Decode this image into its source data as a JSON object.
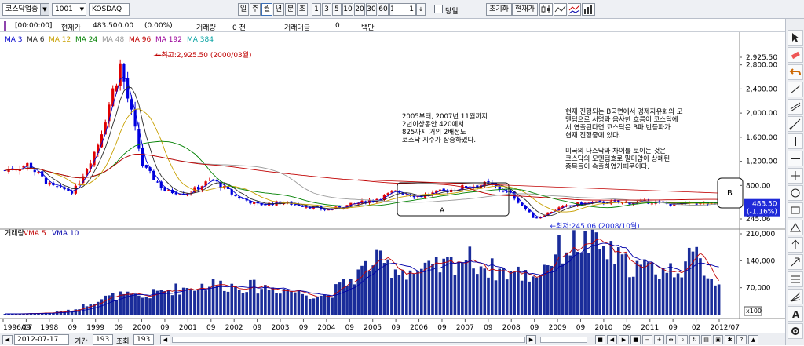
{
  "toolbar": {
    "index_select": "코스닥업종",
    "index_code": "1001",
    "index_name": "KOSDAQ",
    "periods": [
      "일",
      "주",
      "월",
      "년",
      "분",
      "초"
    ],
    "active_period": "월",
    "intervals": [
      "1",
      "3",
      "5",
      "10",
      "20",
      "30",
      "60",
      "120"
    ],
    "spin_value": "1",
    "checkbox_label": "당일",
    "reset_label": "초기화",
    "current_label": "현재가"
  },
  "info": {
    "time": "[00:00:00]",
    "price_label": "현재가",
    "price": "483.50",
    "change": "0.00",
    "change_pct": "(0.00%)",
    "volume_label": "거래량",
    "volume": "0 천",
    "amount_label": "거래대금",
    "amount": "0",
    "amount_unit": "백만"
  },
  "ma_legend": [
    {
      "label": "MA 3",
      "color": "#0000cc"
    },
    {
      "label": "MA 6",
      "color": "#2a2a2a"
    },
    {
      "label": "MA 12",
      "color": "#c8a000"
    },
    {
      "label": "MA 24",
      "color": "#008000"
    },
    {
      "label": "MA 48",
      "color": "#9a9a9a"
    },
    {
      "label": "MA 96",
      "color": "#c00000"
    },
    {
      "label": "MA 192",
      "color": "#990099"
    },
    {
      "label": "MA 384",
      "color": "#00a0a0"
    }
  ],
  "vol_legend": [
    {
      "label": "거래량",
      "color": "#000000"
    },
    {
      "label": "VMA 5",
      "color": "#c00000"
    },
    {
      "label": "VMA 10",
      "color": "#0000aa"
    }
  ],
  "price_axis": [
    "2,925.50",
    "2,800.00",
    "2,400.00",
    "2,000.00",
    "1,600.00",
    "1,200.00",
    "800.00",
    "245.06"
  ],
  "price_tag": {
    "value": "483.50",
    "pct": "(-1.16%)"
  },
  "vol_axis": [
    "210,000",
    "140,000",
    "70,000"
  ],
  "vol_scale": "x100",
  "x_axis": [
    "1996/07",
    "09",
    "1998",
    "09",
    "1999",
    "09",
    "2000",
    "09",
    "2001",
    "09",
    "2002",
    "09",
    "2003",
    "09",
    "2004",
    "09",
    "2005",
    "09",
    "2006",
    "09",
    "2007",
    "09",
    "2008",
    "09",
    "2009",
    "09",
    "2010",
    "09",
    "2011",
    "09",
    "02",
    "2012/07"
  ],
  "annotations": {
    "max_label": "최고:2,925.50 (2000/03월)",
    "min_label": "최저:245.06 (2008/10월)",
    "note_left": [
      "2005부터, 2007년 11월까지",
      "2년이상동안 420에서",
      "825까지 거의 2배정도",
      "코스닥 지수가 상승하였다."
    ],
    "note_right": [
      "현재 진행되는 B국면에서 경제자유화의 모",
      "멘텀으로 서명과 음사한 흐름이 코스닥에",
      "서 연출된다면 코스닥은 B파 반등파가",
      "현재 진행중에 있다.",
      "",
      "미국의 나스닥과 차이를 보이는 것은",
      "코스닥의 모멘텀흐로 말미암아 상폐된",
      "종목들이 속출하였기때문이다."
    ],
    "box_a_label": "A",
    "box_b_label": "B"
  },
  "chart_data": [
    {
      "type": "candlestick",
      "title": "KOSDAQ",
      "frequency": "monthly",
      "x": [
        "1996/07",
        "1997/07",
        "1998/07",
        "1999/01",
        "1999/07",
        "2000/03",
        "2000/09",
        "2001/03",
        "2001/09",
        "2002/03",
        "2002/09",
        "2003/03",
        "2003/09",
        "2004/03",
        "2004/09",
        "2005/03",
        "2005/09",
        "2006/03",
        "2006/09",
        "2007/03",
        "2007/09",
        "2007/11",
        "2008/03",
        "2008/10",
        "2009/03",
        "2009/09",
        "2010/03",
        "2010/09",
        "2011/03",
        "2011/09",
        "2012/03",
        "2012/07"
      ],
      "close": [
        1050,
        1150,
        780,
        700,
        1450,
        2800,
        1100,
        700,
        680,
        900,
        620,
        480,
        520,
        460,
        390,
        480,
        560,
        700,
        620,
        700,
        780,
        825,
        650,
        245,
        420,
        500,
        520,
        510,
        530,
        480,
        510,
        483.5
      ],
      "ylim": [
        245.06,
        2925.5
      ],
      "max": {
        "value": 2925.5,
        "date": "2000/03"
      },
      "min": {
        "value": 245.06,
        "date": "2008/10"
      },
      "ma_periods": [
        3,
        6,
        12,
        24,
        48,
        96,
        192,
        384
      ]
    },
    {
      "type": "bar",
      "title": "거래량",
      "unit": "x100",
      "x": [
        "1996/07",
        "1997/07",
        "1998/07",
        "1999/01",
        "1999/07",
        "2000/03",
        "2000/09",
        "2001/03",
        "2001/09",
        "2002/03",
        "2002/09",
        "2003/03",
        "2003/09",
        "2004/03",
        "2004/09",
        "2005/03",
        "2005/09",
        "2006/03",
        "2006/09",
        "2007/03",
        "2007/09",
        "2007/11",
        "2008/03",
        "2008/10",
        "2009/03",
        "2009/09",
        "2010/03",
        "2010/09",
        "2011/03",
        "2011/09",
        "2012/03",
        "2012/07"
      ],
      "values": [
        2000,
        3000,
        5000,
        12000,
        40000,
        50000,
        45000,
        65000,
        70000,
        80000,
        75000,
        72000,
        68000,
        55000,
        50000,
        90000,
        140000,
        120000,
        110000,
        125000,
        150000,
        120000,
        110000,
        100000,
        165000,
        190000,
        170000,
        130000,
        120000,
        115000,
        150000,
        75000
      ],
      "ylim": [
        0,
        210000
      ],
      "vma_periods": [
        5,
        10
      ]
    }
  ],
  "status": {
    "date": "2012-07-17",
    "period_label": "기간",
    "period_value": "193",
    "view_label": "조회",
    "view_value": "193"
  }
}
